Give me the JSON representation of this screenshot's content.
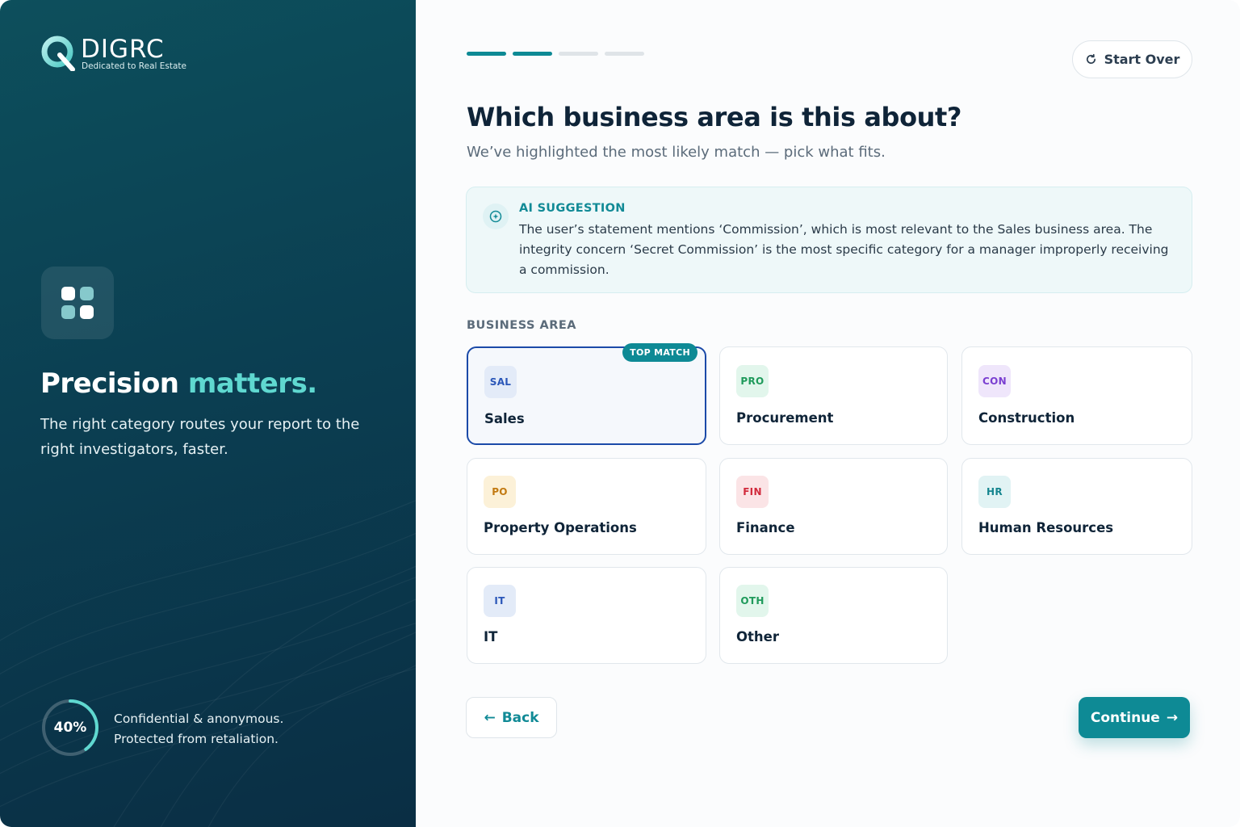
{
  "brand": {
    "name": "DIGRC",
    "tagline": "Dedicated to Real Estate"
  },
  "left_panel": {
    "tile_icon": "grid-icon",
    "hero_title_main": "Precision",
    "hero_title_accent": "matters.",
    "hero_subtitle": "The right category routes your report to the right investigators, faster.",
    "progress_label": "40%",
    "progress_value": 0.4,
    "confidential_line1": "Confidential & anonymous.",
    "confidential_line2": "Protected from retaliation."
  },
  "steps": {
    "total": 4,
    "completed": 2
  },
  "header": {
    "start_over_label": "Start Over",
    "start_over_icon": "refresh-icon"
  },
  "question": {
    "title": "Which business area is this about?",
    "subtitle": "We’ve highlighted the most likely match — pick what fits."
  },
  "ai_suggestion": {
    "heading": "AI SUGGESTION",
    "icon": "sparkle-icon",
    "text": "The user’s statement mentions ‘Commission’, which is most relevant to the Sales business area. The integrity concern ‘Secret Commission’ is the most specific category for a manager improperly receiving a commission."
  },
  "business_area": {
    "section_label": "BUSINESS AREA",
    "top_match_label": "TOP MATCH",
    "selected": "Sales",
    "options": [
      {
        "code": "SAL",
        "label": "Sales",
        "badge_bg": "#e3ebf8",
        "badge_fg": "#2a56b8"
      },
      {
        "code": "PRO",
        "label": "Procurement",
        "badge_bg": "#e2f6ec",
        "badge_fg": "#1f9a5b"
      },
      {
        "code": "CON",
        "label": "Construction",
        "badge_bg": "#efe6fb",
        "badge_fg": "#7a3fd1"
      },
      {
        "code": "PO",
        "label": "Property Operations",
        "badge_bg": "#fcf1d8",
        "badge_fg": "#c27a12"
      },
      {
        "code": "FIN",
        "label": "Finance",
        "badge_bg": "#fbe4e6",
        "badge_fg": "#d12a3c"
      },
      {
        "code": "HR",
        "label": "Human Resources",
        "badge_bg": "#e1f3f4",
        "badge_fg": "#15858f"
      },
      {
        "code": "IT",
        "label": "IT",
        "badge_bg": "#e3ebf8",
        "badge_fg": "#2a56b8"
      },
      {
        "code": "OTH",
        "label": "Other",
        "badge_bg": "#e2f6ec",
        "badge_fg": "#1f9a5b"
      }
    ]
  },
  "footer": {
    "back_label": "Back",
    "continue_label": "Continue"
  },
  "colors": {
    "accent": "#0e8a95",
    "selected_border": "#1b4aa8",
    "left_panel": "#0b3f52",
    "hero_accent": "#5fd8d0"
  }
}
